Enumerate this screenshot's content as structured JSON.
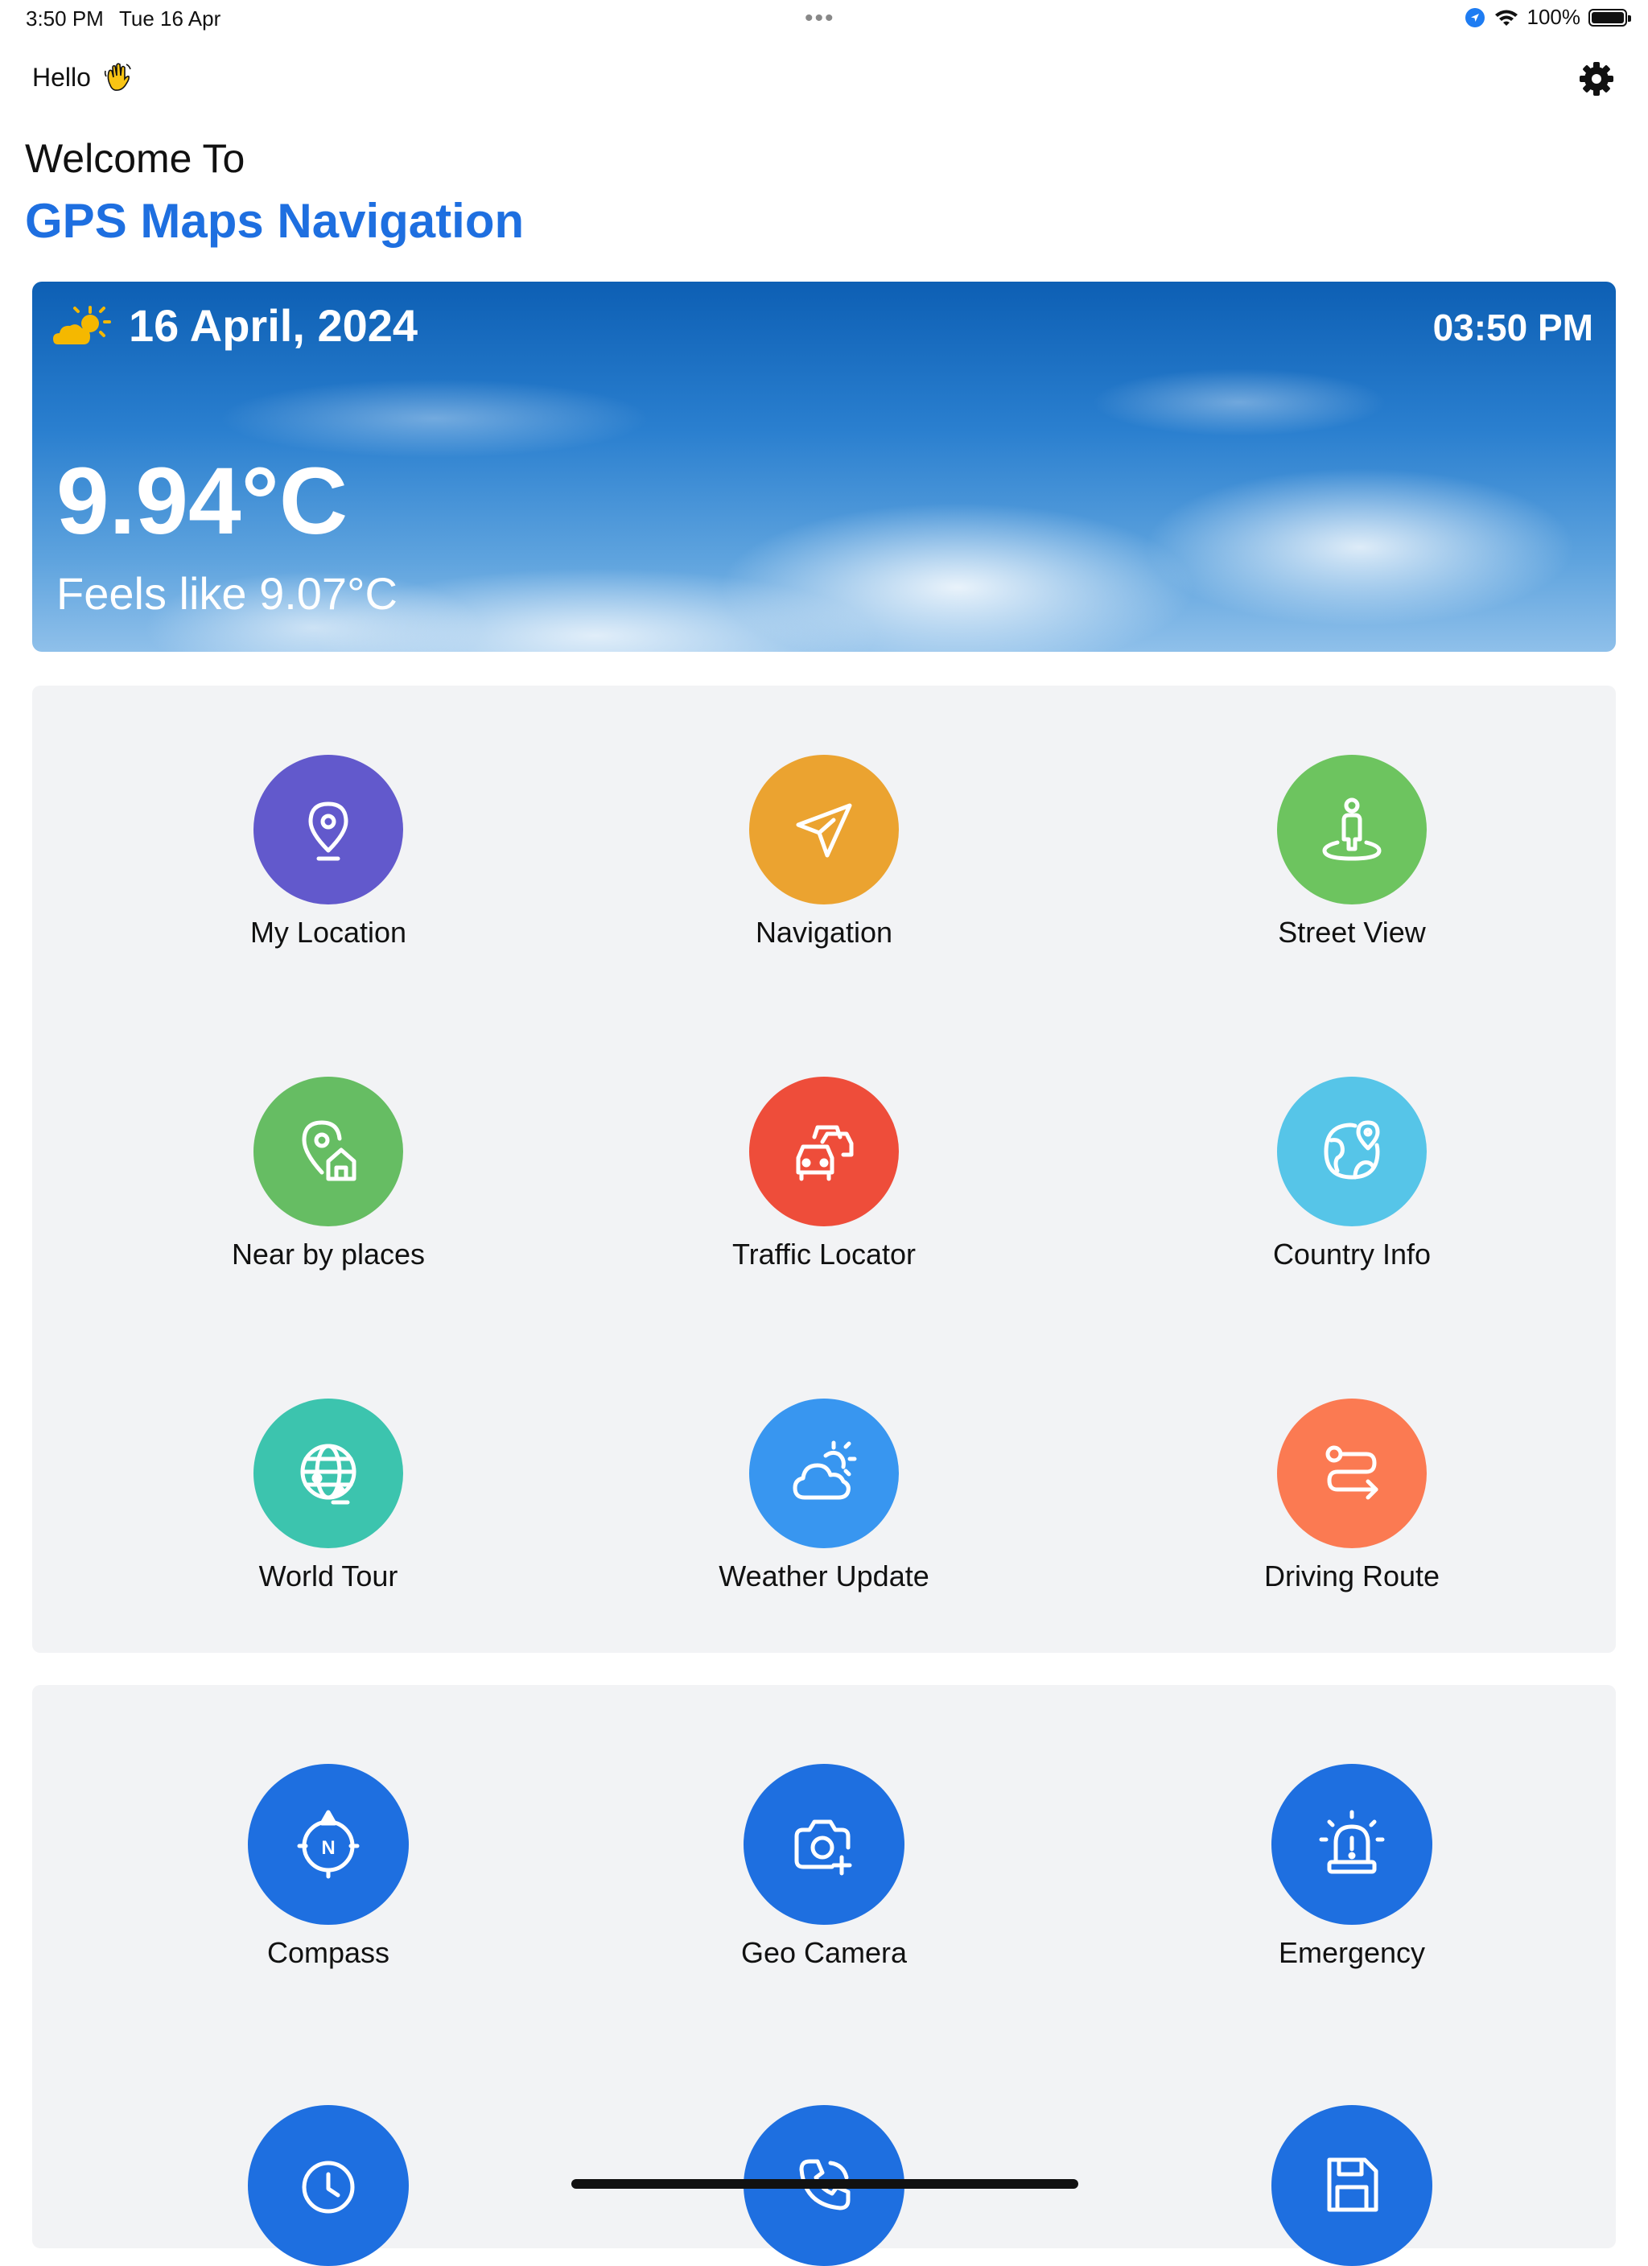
{
  "status_bar": {
    "time": "3:50 PM",
    "date": "Tue 16 Apr",
    "dots": "•••",
    "battery_text": "100%",
    "icons": [
      "location-arrow-icon",
      "wifi-icon",
      "battery-icon"
    ]
  },
  "header": {
    "greeting": "Hello",
    "greeting_icon": "waving-hand-icon",
    "settings_icon": "gear-icon",
    "welcome": "Welcome To",
    "app_title": "GPS Maps Navigation",
    "accent": "#1e6fe0"
  },
  "weather": {
    "date": "16 April, 2024",
    "time": "03:50 PM",
    "temperature": "9.94°C",
    "feels_like": "Feels like 9.07°C",
    "icon": "partly-sunny-icon"
  },
  "features": [
    {
      "label": "My Location",
      "icon": "location-pin-icon",
      "color": "#6259cc"
    },
    {
      "label": "Navigation",
      "icon": "send-arrow-icon",
      "color": "#eba330"
    },
    {
      "label": "Street View",
      "icon": "street-view-person-icon",
      "color": "#6dc45f"
    },
    {
      "label": "Near by places",
      "icon": "pin-home-icon",
      "color": "#66bd63"
    },
    {
      "label": "Traffic Locator",
      "icon": "cars-icon",
      "color": "#ee4d3a"
    },
    {
      "label": "Country Info",
      "icon": "globe-pin-icon",
      "color": "#56c5e8"
    },
    {
      "label": "World Tour",
      "icon": "globe-route-icon",
      "color": "#3cc4ae"
    },
    {
      "label": "Weather Update",
      "icon": "cloud-sun-icon",
      "color": "#3896f0"
    },
    {
      "label": "Driving Route",
      "icon": "route-icon",
      "color": "#fb7a52"
    }
  ],
  "tools": [
    {
      "label": "Compass",
      "icon": "compass-icon",
      "color": "#1e6fe0"
    },
    {
      "label": "Geo Camera",
      "icon": "camera-plus-icon",
      "color": "#1e6fe0"
    },
    {
      "label": "Emergency",
      "icon": "siren-icon",
      "color": "#1e6fe0"
    },
    {
      "label": "",
      "icon": "clock-icon",
      "color": "#1e6fe0"
    },
    {
      "label": "",
      "icon": "phone-icon",
      "color": "#1e6fe0"
    },
    {
      "label": "",
      "icon": "save-icon",
      "color": "#1e6fe0"
    }
  ]
}
